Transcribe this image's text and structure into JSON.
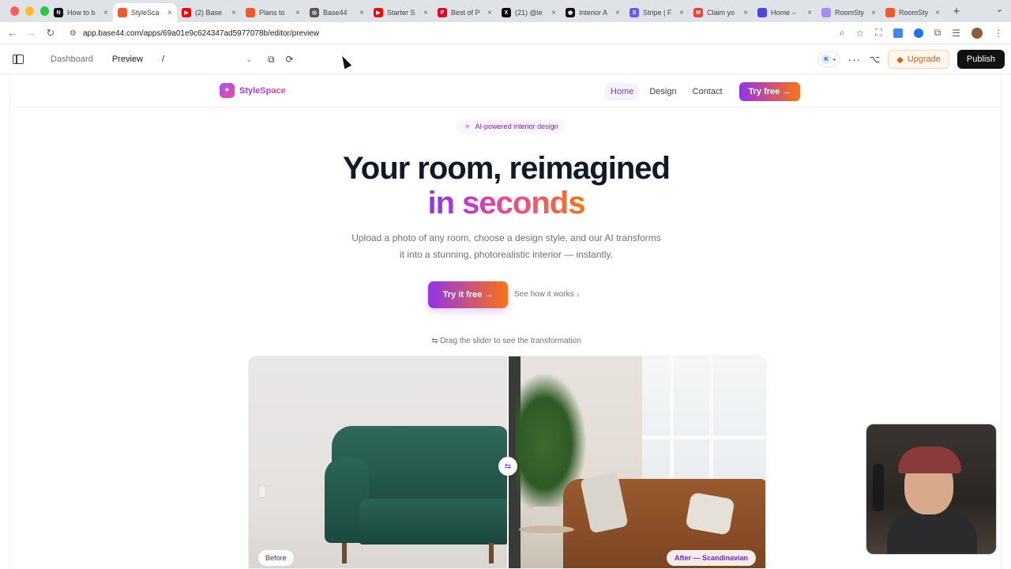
{
  "browser": {
    "tabs": [
      {
        "title": "How to b",
        "fav_color": "#111111",
        "fav_glyph": "N",
        "active": false
      },
      {
        "title": "StyleSca",
        "fav_color": "#f05a28",
        "fav_glyph": "",
        "active": true
      },
      {
        "title": "(2) Base",
        "fav_color": "#ff0000",
        "fav_glyph": "▶",
        "active": false
      },
      {
        "title": "Plans to",
        "fav_color": "#f05a28",
        "fav_glyph": "",
        "active": false
      },
      {
        "title": "Base44",
        "fav_color": "#555555",
        "fav_glyph": "◎",
        "active": false
      },
      {
        "title": "Starter S",
        "fav_color": "#ff0000",
        "fav_glyph": "▶",
        "active": false
      },
      {
        "title": "Best of P",
        "fav_color": "#e60023",
        "fav_glyph": "P",
        "active": false
      },
      {
        "title": "(21) @le",
        "fav_color": "#000000",
        "fav_glyph": "X",
        "active": false
      },
      {
        "title": "Interior A",
        "fav_color": "#111111",
        "fav_glyph": "◉",
        "active": false
      },
      {
        "title": "Stripe | F",
        "fav_color": "#635bff",
        "fav_glyph": "S",
        "active": false
      },
      {
        "title": "Claim yo",
        "fav_color": "#ea4335",
        "fav_glyph": "M",
        "active": false
      },
      {
        "title": "Home –",
        "fav_color": "#4f46e5",
        "fav_glyph": "",
        "active": false
      },
      {
        "title": "RoomSty",
        "fav_color": "#a78bfa",
        "fav_glyph": "",
        "active": false
      },
      {
        "title": "RoomSty",
        "fav_color": "#f05a28",
        "fav_glyph": "",
        "active": false
      }
    ],
    "new_tab": "+",
    "url": "app.base44.com/apps/69a01e9c624347ad5977078b/editor/preview"
  },
  "editor": {
    "dashboard_label": "Dashboard",
    "preview_label": "Preview",
    "route_value": "/",
    "avatar_initial": "K",
    "avatar_add": "+",
    "upgrade_label": "Upgrade",
    "publish_label": "Publish"
  },
  "site": {
    "brand_name": "StyleSpace",
    "nav": {
      "home": "Home",
      "design": "Design",
      "contact": "Contact",
      "cta": "Try free →"
    },
    "badge": "AI-powered interior design",
    "hero_title": "Your room, reimagined",
    "hero_accent": "in seconds",
    "hero_sub": "Upload a photo of any room, choose a design style, and our AI transforms it into a stunning, photorealistic interior — instantly.",
    "hero_cta": "Try it free  →",
    "hero_link": "See how it works ↓",
    "slider_hint": "⇆  Drag the slider to see the transformation",
    "before_label": "Before",
    "after_label": "After — Scandinavian",
    "slider_position": 0.5
  },
  "colors": {
    "brand_purple": "#9333ea",
    "brand_orange": "#f97316",
    "publish_bg": "#111111",
    "upgrade_text": "#ea580c"
  }
}
